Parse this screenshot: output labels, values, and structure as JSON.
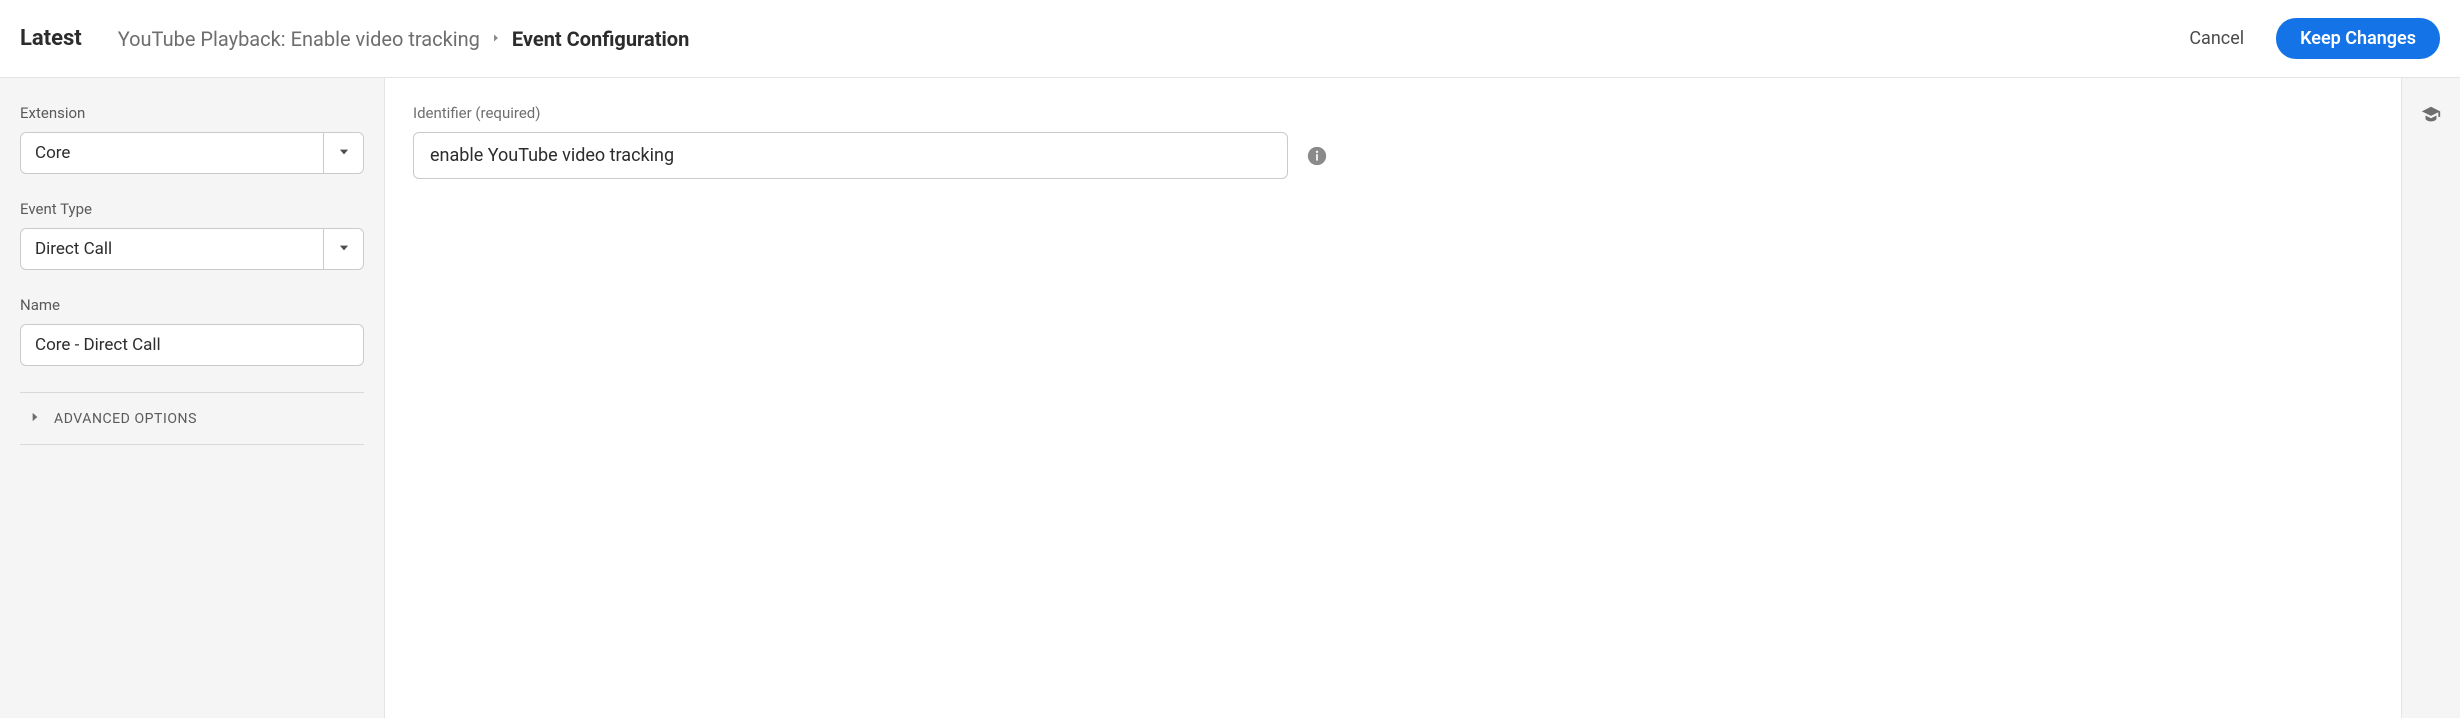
{
  "header": {
    "title": "Latest",
    "breadcrumb": {
      "item1": "YouTube Playback: Enable video tracking",
      "current": "Event Configuration"
    },
    "actions": {
      "cancel": "Cancel",
      "keep_changes": "Keep Changes"
    }
  },
  "sidebar": {
    "extension": {
      "label": "Extension",
      "value": "Core"
    },
    "event_type": {
      "label": "Event Type",
      "value": "Direct Call"
    },
    "name": {
      "label": "Name",
      "value": "Core - Direct Call"
    },
    "advanced_label": "ADVANCED OPTIONS"
  },
  "main": {
    "identifier": {
      "label": "Identifier (required)",
      "value": "enable YouTube video tracking"
    }
  }
}
